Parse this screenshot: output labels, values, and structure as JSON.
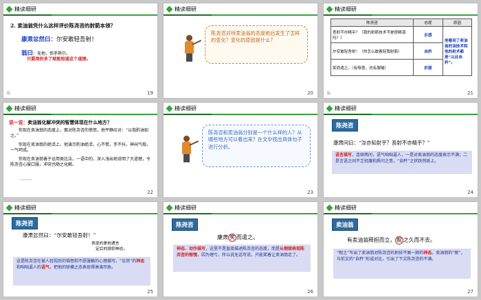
{
  "header_title": "精读细研",
  "slides": {
    "s19": {
      "num": "19",
      "pg": "治",
      "question": "2. 卖油翁凭什么这样评价陈尧咨的射箭本领？",
      "line1_speaker": "康肃忿然曰",
      "line1_text": "：尔安敢轻吾射！",
      "line2_speaker": "翁曰",
      "line2_text": "：无他，但手熟尔。",
      "line2_note": "只要用的多了就能知道这个道理。"
    },
    "s20": {
      "num": "20",
      "bubble": "陈尧咨对待卖油翁的态度前后发生了怎样的变化？变化的原因是什么？"
    },
    "s21": {
      "num": "21",
      "pg": "治",
      "headers": [
        "陈尧咨",
        "态度",
        "原因"
      ],
      "rows": [
        {
          "quote": "吾射不亦精乎？（我的射箭技术不是很精湛吗？）",
          "attitude": "自矜"
        },
        {
          "quote": "尔安敢轻吾射！（你怎么敢看轻我射箭）",
          "attitude": "愤怒"
        },
        {
          "quote": "笑而遣之。（有惭意，也有服输）",
          "attitude": "折服"
        }
      ],
      "reason": "他看到了卖油翁的油技术和他的射术都是“以此自矜”。",
      "reason_cells": [
        "反感"
      ]
    },
    "s22": {
      "num": "22",
      "title_red": "说一说：",
      "title_rest": "卖油翁化解冲突的智慧体现在什么地方？",
      "p1": "你现在卖油翁的态度上，面对陈尧咨的愤怒，他平静应对：“以我酌油知之。”",
      "p2": "你现在卖油翁的绝活上，他演示酌油绝活，心不慌，手不抖，神闲气稳，一气呵成。",
      "p3": "你现在卖油翁善于运用类比法，一语中的，深入浅出地说明了大道理，令陈尧咨心服口服，冲突也随之化解。",
      "dots": "………"
    },
    "s23": {
      "num": "23",
      "bubble": "陈尧咨和卖油翁分别是一个什么样的人？从哪些地方可以看出来？在文中找出具体句子进行分析。"
    },
    "s24": {
      "num": "24",
      "name": "陈尧咨",
      "quote": "康肃问曰：“汝亦知射乎？吾射不亦精乎？”",
      "label": "语言描写",
      "body": "，连续两问，语气咄咄逼人，一是对卖油翁的态度表示不满；二是言语之间不乏轻蔑和质问之意，“自矜”之状跃然纸上。"
    },
    "s25": {
      "num": "25",
      "name": "陈尧咨",
      "quote": "康肃忿然曰：“尔安敢轻吾射！”",
      "anno1": "表现的是他遇言",
      "anno2": "定后的狼狈神态。",
      "body1": "这是陈尧咨在被人轻视后的恼怒和不愿服輸的心理描写。“忿然”的",
      "body_red": "神态",
      "body2": "和咄咄逼人的",
      "body_red2": "语气",
      "body3": "，把他的骄横之态表现得淋漓尽致。"
    },
    "s26": {
      "num": "26",
      "name": "陈尧咨",
      "quote_a": "康肃",
      "quote_circ": "笑",
      "quote_b": "而遣之。",
      "label": "神态、动作描写",
      "body1": "，这里不是直接描述陈尧咨的态度，而是",
      "body_red": "从侧面表现陈尧咨的惭愧",
      "body2": "，因为理亏，所以说无话可说，只能笑着让卖油翁走了。"
    },
    "s27": {
      "num": "27",
      "name": "卖油翁",
      "quote_a": "有卖油翁释担而立，",
      "quote_circ": "睨",
      "quote_b": "之久而不去。",
      "body1": "“睨之”写出了卖油翁对陈尧咨的射技不屑一顾的",
      "body_red": "神态",
      "body2": "。卖油翁的“睨”，与前文的“自矜”形成对比，引出了下文陈尧咨的不满。"
    }
  }
}
